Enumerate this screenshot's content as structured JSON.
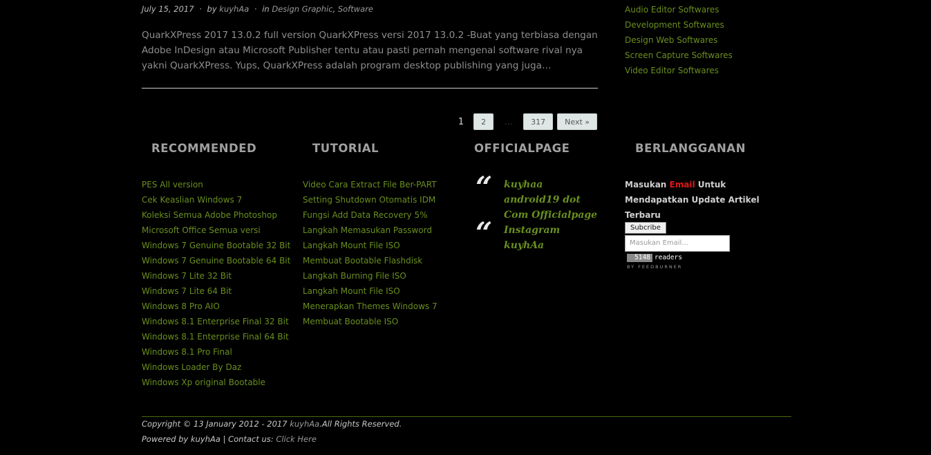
{
  "post": {
    "date": "July 15, 2017",
    "sep1": "·",
    "by": "by",
    "author": "kuyhAa",
    "sep2": "·",
    "in": "in",
    "category1": "Design Graphic",
    "comma": ",",
    "category2": "Software",
    "excerpt": "QuarkXPress 2017 13.0.2 full version QuarkXPress versi 2017 13.0.2 -Buat yang terbiasa dengan Adobe InDesign atau Microsoft Publisher tentu atau pasti pernah mengenal software rival nya yakni QuarkXPress. Yups, QuarkXPress adalah program desktop publishing yang juga…"
  },
  "sidebar": {
    "categories": [
      "Audio Editor Softwares",
      "Development Softwares",
      "Design Web Softwares",
      "Screen Capture Softwares",
      "Video Editor Softwares"
    ]
  },
  "pagination": {
    "current": "1",
    "page2": "2",
    "dots": "…",
    "last": "317",
    "next": "Next »"
  },
  "widgets": {
    "recommended": {
      "title": "RECOMMENDED",
      "items": [
        "PES All version",
        "Cek Keaslian Windows 7",
        "Koleksi Semua Adobe Photoshop",
        "Microsoft Office Semua versi",
        "Windows 7 Genuine Bootable 32 Bit",
        "Windows 7 Genuine Bootable 64 Bit",
        "Windows 7 Lite 32 Bit",
        "Windows 7 Lite 64 Bit",
        "Windows 8 Pro AIO",
        "Windows 8.1 Enterprise Final 32 Bit",
        "Windows 8.1 Enterprise Final 64 Bit",
        "Windows 8.1 Pro Final",
        "Windows Loader By Daz",
        "Windows Xp original Bootable"
      ]
    },
    "tutorial": {
      "title": "TUTORIAL",
      "items": [
        "Video Cara Extract File Ber-PART",
        "Setting Shutdown Otomatis IDM",
        "Fungsi Add Data Recovery 5%",
        "Langkah Memasukan Password",
        "Langkah Mount File ISO",
        "Membuat Bootable Flashdisk",
        "Langkah Burning File ISO",
        "Langkah Mount File ISO",
        "Menerapkan Themes Windows 7",
        "Membuat Bootable ISO"
      ]
    },
    "officialpage": {
      "title": "OFFICIALPAGE",
      "quote_glyph": "“",
      "quote1": "kuyhaa android19 dot Com Officialpage",
      "quote2": "Instagram kuyhAa"
    },
    "berlangganan": {
      "title": "BERLANGGANAN",
      "text_before": "Masukan ",
      "text_email": "Email",
      "text_after": " Untuk Mendapatkan Update Artikel Terbaru",
      "button": "Subcribe",
      "placeholder": "Masukan Email...",
      "readers_count": "5148",
      "readers_label": "readers",
      "by_feedburner": "BY FEEDBURNER"
    }
  },
  "footer": {
    "copyright_prefix": "Copyright © 13 January 2012 - 2017 ",
    "copyright_link": "kuyhAa",
    "copyright_suffix": ".All Rights Reserved.",
    "powered_prefix": "Powered by kuyhAa | Contact us: ",
    "contact_link": "Click Here"
  },
  "colors": {
    "background": "#000000",
    "link_green": "#6a8f1e",
    "accent_red": "#e01818"
  }
}
